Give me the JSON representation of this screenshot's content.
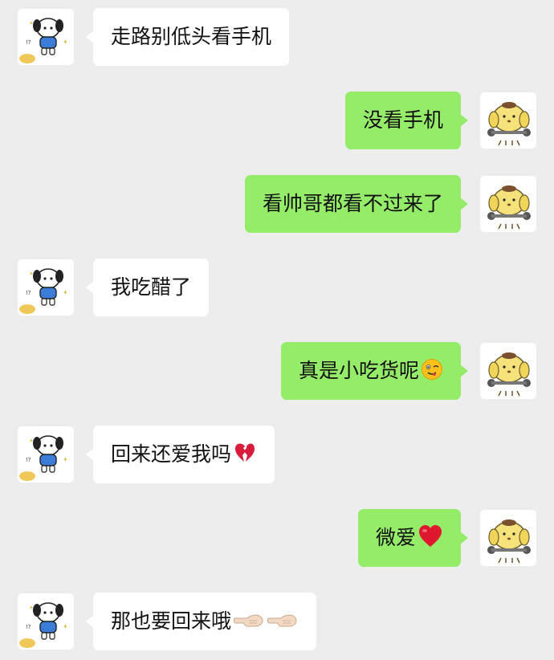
{
  "conversation": {
    "messages": [
      {
        "side": "left",
        "text": "走路别低头看手机",
        "emoji": []
      },
      {
        "side": "right",
        "text": "没看手机",
        "emoji": []
      },
      {
        "side": "right",
        "text": "看帅哥都看不过来了",
        "emoji": []
      },
      {
        "side": "left",
        "text": "我吃醋了",
        "emoji": []
      },
      {
        "side": "right",
        "text": "真是小吃货呢",
        "emoji": [
          "winking-face-emoji"
        ]
      },
      {
        "side": "left",
        "text": "回来还爱我吗",
        "emoji": [
          "broken-heart-emoji"
        ]
      },
      {
        "side": "right",
        "text": "微爱",
        "emoji": [
          "red-heart-emoji"
        ]
      },
      {
        "side": "left",
        "text": "那也要回来哦",
        "emoji": [
          "pointing-left-hand-emoji",
          "pointing-left-hand-emoji"
        ]
      }
    ]
  },
  "avatars": {
    "left": "white-puppy-avatar",
    "right": "yellow-pompom-dog-avatar"
  },
  "colors": {
    "background": "#ededed",
    "incoming_bubble": "#ffffff",
    "outgoing_bubble": "#95ec69",
    "text": "#111111"
  }
}
